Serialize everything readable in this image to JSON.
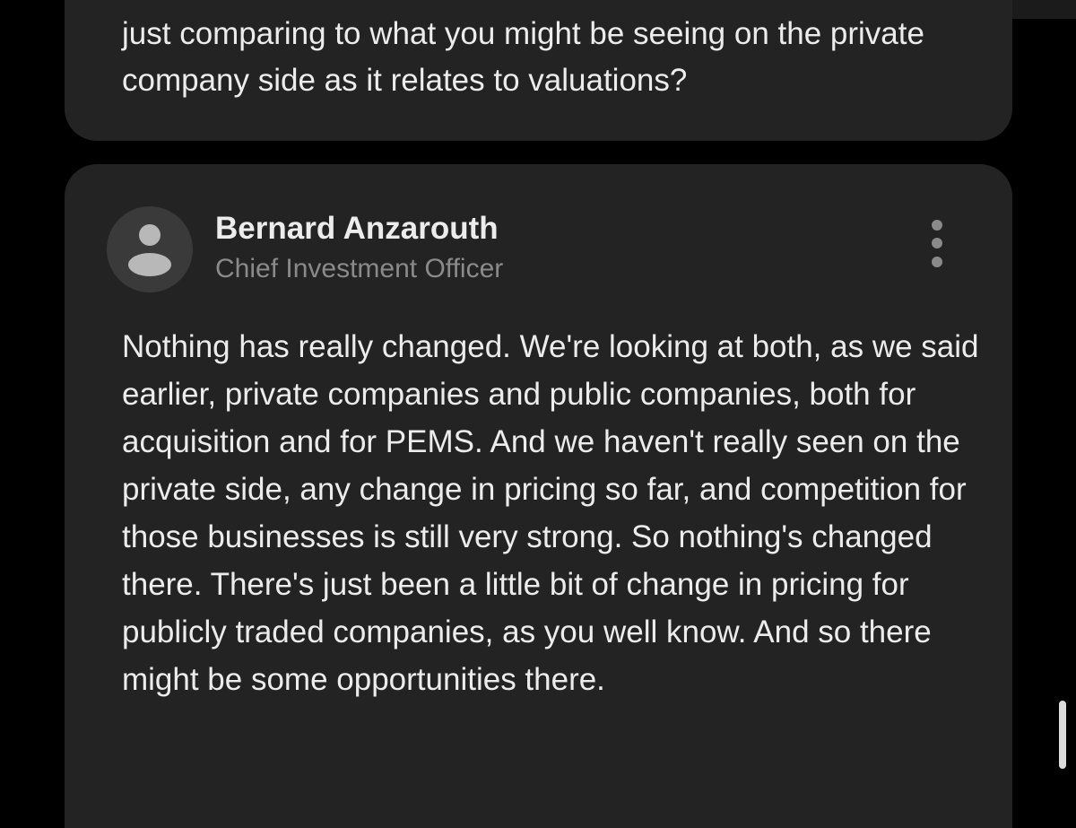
{
  "question": {
    "text": "just comparing to what you might be seeing on the private company side as it relates to valuations?"
  },
  "answer": {
    "speaker_name": "Bernard Anzarouth",
    "speaker_title": "Chief Investment Officer",
    "avatar_icon": "person-icon",
    "more_icon": "more-vertical-icon",
    "text": "Nothing has really changed. We're looking at both, as we said earlier, private companies and public companies, both for acquisition and for PEMS. And we haven't really seen on the private side, any change in pricing so far, and competition for those businesses is still very strong. So nothing's changed there. There's just been a little bit of change in pricing for publicly traded companies, as you well know. And so there might be some opportunities there."
  },
  "colors": {
    "background": "#000000",
    "card": "#232323",
    "primary_text": "#ececec",
    "secondary_text": "#8a8a8a"
  }
}
